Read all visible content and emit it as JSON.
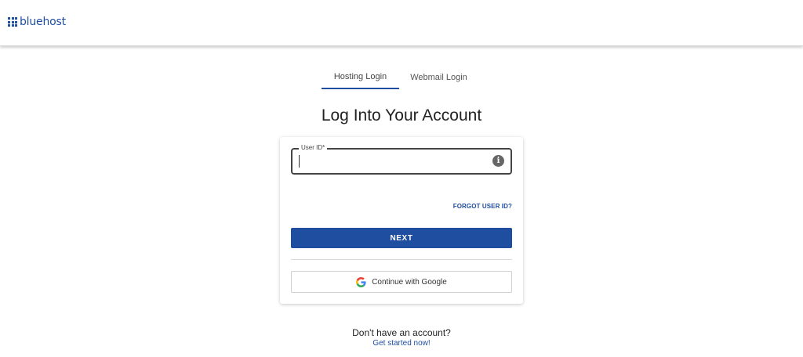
{
  "header": {
    "brand": "bluehost",
    "brand_color": "#1f4ea1"
  },
  "tabs": [
    {
      "label": "Hosting Login",
      "active": true
    },
    {
      "label": "Webmail Login",
      "active": false
    }
  ],
  "page_title": "Log Into Your Account",
  "form": {
    "user_id_label": "User ID*",
    "user_id_value": "",
    "info_icon": "info-icon",
    "forgot_link": "FORGOT USER ID?",
    "next_label": "NEXT",
    "google_label": "Continue with Google"
  },
  "footer": {
    "prompt": "Don't have an account?",
    "signup_link": "Get started now!"
  }
}
